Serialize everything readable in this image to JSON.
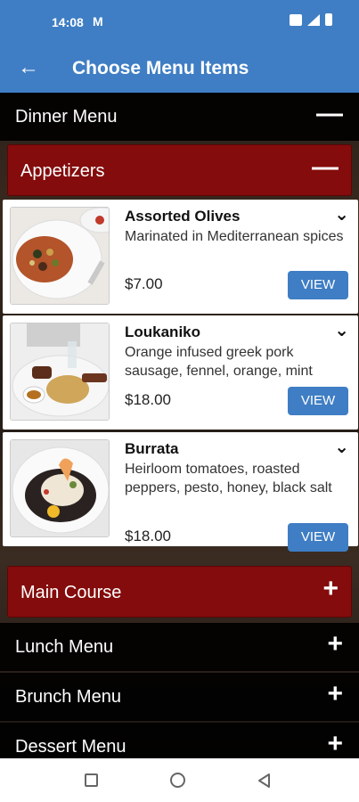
{
  "status": {
    "time": "14:08",
    "mail_glyph": "M"
  },
  "appbar": {
    "back_glyph": "←",
    "title": "Choose Menu Items"
  },
  "menus": [
    {
      "label": "Dinner Menu",
      "toggle": "—"
    },
    {
      "label": "Lunch Menu",
      "toggle": "+"
    },
    {
      "label": "Brunch Menu",
      "toggle": "+"
    },
    {
      "label": "Dessert Menu",
      "toggle": "+"
    }
  ],
  "categories": [
    {
      "label": "Appetizers",
      "toggle": "—"
    },
    {
      "label": "Main Course",
      "toggle": "+"
    }
  ],
  "items": [
    {
      "name": "Assorted Olives",
      "description": "Marinated in Mediterranean spices",
      "price": "$7.00",
      "view": "VIEW",
      "chevron": "⌄"
    },
    {
      "name": "Loukaniko",
      "description": "Orange infused greek pork sausage, fennel, orange, mint",
      "price": "$18.00",
      "view": "VIEW",
      "chevron": "⌄"
    },
    {
      "name": "Burrata",
      "description": "Heirloom tomatoes, roasted peppers, pesto, honey, black salt",
      "price": "$18.00",
      "view": "VIEW",
      "chevron": "⌄"
    }
  ],
  "colors": {
    "accent": "#3f7ec4",
    "category": "#840c0c"
  }
}
